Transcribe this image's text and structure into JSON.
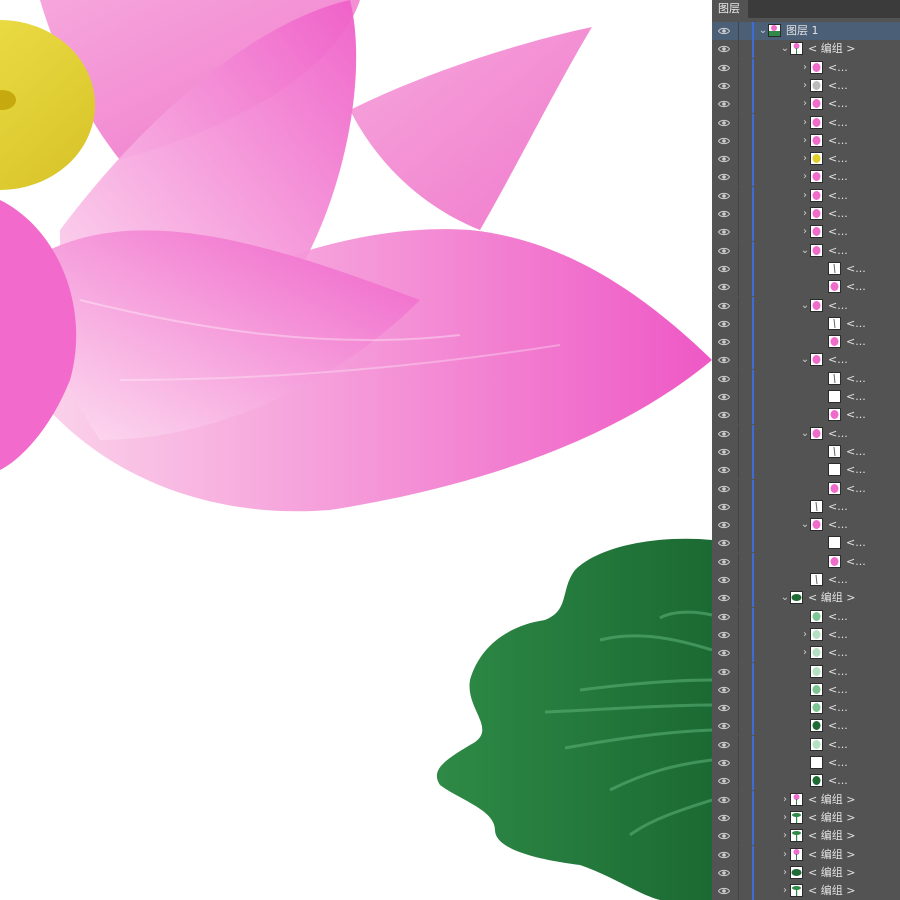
{
  "panel": {
    "tab_label": "图层",
    "layer_name": "图层 1",
    "group_label": "< 编组 >",
    "item_label": "<..."
  },
  "colors": {
    "panel_bg": "#535353",
    "selected_row": "#4b5f77",
    "indent_bar": "#3e6bd6",
    "petal_pink": "#f06ccb",
    "petal_light": "#fde0f1",
    "stamen_yellow": "#e8d83a",
    "leaf_green": "#2f8a47",
    "leaf_dark": "#1f6b35"
  },
  "rows": [
    {
      "level": 0,
      "chev": "down",
      "thumb": "scene",
      "label": "layer",
      "selected": true
    },
    {
      "level": 1,
      "chev": "down",
      "thumb": "flower",
      "label": "group"
    },
    {
      "level": 2,
      "chev": "right",
      "thumb": "pink",
      "label": "item"
    },
    {
      "level": 2,
      "chev": "right",
      "thumb": "grey",
      "label": "item"
    },
    {
      "level": 2,
      "chev": "right",
      "thumb": "pink",
      "label": "item"
    },
    {
      "level": 2,
      "chev": "right",
      "thumb": "pink",
      "label": "item"
    },
    {
      "level": 2,
      "chev": "right",
      "thumb": "pink",
      "label": "item"
    },
    {
      "level": 2,
      "chev": "right",
      "thumb": "yellow",
      "label": "item"
    },
    {
      "level": 2,
      "chev": "right",
      "thumb": "pink",
      "label": "item"
    },
    {
      "level": 2,
      "chev": "right",
      "thumb": "pink",
      "label": "item"
    },
    {
      "level": 2,
      "chev": "right",
      "thumb": "pink",
      "label": "item"
    },
    {
      "level": 2,
      "chev": "right",
      "thumb": "pink",
      "label": "item"
    },
    {
      "level": 2,
      "chev": "down",
      "thumb": "pink",
      "label": "item"
    },
    {
      "level": 3,
      "chev": "none",
      "thumb": "stroke",
      "label": "item"
    },
    {
      "level": 3,
      "chev": "none",
      "thumb": "pink",
      "label": "item"
    },
    {
      "level": 2,
      "chev": "down",
      "thumb": "pink",
      "label": "item"
    },
    {
      "level": 3,
      "chev": "none",
      "thumb": "stroke",
      "label": "item"
    },
    {
      "level": 3,
      "chev": "none",
      "thumb": "pink",
      "label": "item"
    },
    {
      "level": 2,
      "chev": "down",
      "thumb": "pink",
      "label": "item"
    },
    {
      "level": 3,
      "chev": "none",
      "thumb": "stroke",
      "label": "item"
    },
    {
      "level": 3,
      "chev": "none",
      "thumb": "blank",
      "label": "item"
    },
    {
      "level": 3,
      "chev": "none",
      "thumb": "pink",
      "label": "item"
    },
    {
      "level": 2,
      "chev": "down",
      "thumb": "pink",
      "label": "item"
    },
    {
      "level": 3,
      "chev": "none",
      "thumb": "stroke",
      "label": "item"
    },
    {
      "level": 3,
      "chev": "none",
      "thumb": "blank",
      "label": "item"
    },
    {
      "level": 3,
      "chev": "none",
      "thumb": "pink",
      "label": "item"
    },
    {
      "level": 2,
      "chev": "none",
      "thumb": "stroke",
      "label": "item"
    },
    {
      "level": 2,
      "chev": "down",
      "thumb": "pink",
      "label": "item"
    },
    {
      "level": 3,
      "chev": "none",
      "thumb": "blank",
      "label": "item"
    },
    {
      "level": 3,
      "chev": "none",
      "thumb": "pink",
      "label": "item"
    },
    {
      "level": 2,
      "chev": "none",
      "thumb": "stroke",
      "label": "item"
    },
    {
      "level": 1,
      "chev": "down",
      "thumb": "leaf",
      "label": "group"
    },
    {
      "level": 2,
      "chev": "none",
      "thumb": "green",
      "label": "item"
    },
    {
      "level": 2,
      "chev": "right",
      "thumb": "lightgreen",
      "label": "item"
    },
    {
      "level": 2,
      "chev": "right",
      "thumb": "lightgreen",
      "label": "item"
    },
    {
      "level": 2,
      "chev": "none",
      "thumb": "lightgreen",
      "label": "item"
    },
    {
      "level": 2,
      "chev": "none",
      "thumb": "green",
      "label": "item"
    },
    {
      "level": 2,
      "chev": "none",
      "thumb": "green",
      "label": "item"
    },
    {
      "level": 2,
      "chev": "none",
      "thumb": "darkgreen",
      "label": "item"
    },
    {
      "level": 2,
      "chev": "none",
      "thumb": "lightgreen",
      "label": "item"
    },
    {
      "level": 2,
      "chev": "none",
      "thumb": "blank",
      "label": "item"
    },
    {
      "level": 2,
      "chev": "none",
      "thumb": "darkgreen",
      "label": "item"
    },
    {
      "level": 1,
      "chev": "right",
      "thumb": "flower",
      "label": "group"
    },
    {
      "level": 1,
      "chev": "right",
      "thumb": "stem",
      "label": "group"
    },
    {
      "level": 1,
      "chev": "right",
      "thumb": "stem",
      "label": "group"
    },
    {
      "level": 1,
      "chev": "right",
      "thumb": "flower",
      "label": "group"
    },
    {
      "level": 1,
      "chev": "right",
      "thumb": "leaf",
      "label": "group"
    },
    {
      "level": 1,
      "chev": "right",
      "thumb": "stem",
      "label": "group"
    },
    {
      "level": 1,
      "chev": "right",
      "thumb": "flower",
      "label": "group"
    }
  ]
}
